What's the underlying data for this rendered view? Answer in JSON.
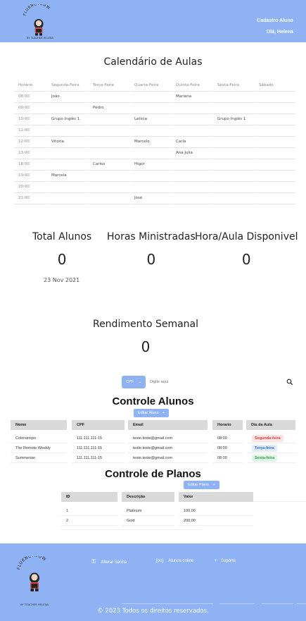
{
  "brand": {
    "name": "FLUENCYNOW",
    "tagline": "BY TEACHER HELENA"
  },
  "header": {
    "cadastro_link": "Cadastro Aluno",
    "greeting": "Olá, Helena"
  },
  "calendar": {
    "title": "Calendário de Aulas",
    "columns": [
      "Horário",
      "Segunda-Feira",
      "Terça-Feira",
      "Quarta-Feira",
      "Quinta-Feira",
      "Sexta-Feira",
      "Sábado"
    ],
    "rows": [
      [
        "08:00",
        "João",
        "",
        "",
        "Mariana",
        "",
        ""
      ],
      [
        "09:00",
        "",
        "Pedro",
        "",
        "",
        "",
        ""
      ],
      [
        "10:00",
        "Grupo Inglês 1",
        "",
        "Leticia",
        "",
        "Grupo Inglês 1",
        ""
      ],
      [
        "11:00",
        "",
        "",
        "",
        "",
        "",
        ""
      ],
      [
        "12:00",
        "Vitoria",
        "",
        "Marcelo",
        "Carla",
        "",
        ""
      ],
      [
        "13:00",
        "",
        "",
        "",
        "Ana Julia",
        "",
        ""
      ],
      [
        "18:00",
        "",
        "Carlos",
        "Higor",
        "",
        "",
        ""
      ],
      [
        "19:00",
        "Marcela",
        "",
        "",
        "",
        "",
        ""
      ],
      [
        "20:00",
        "",
        "",
        "",
        "",
        "",
        ""
      ],
      [
        "21:00",
        "",
        "",
        "José",
        "",
        "",
        ""
      ]
    ]
  },
  "stats": {
    "total_alunos": {
      "label": "Total Alunos",
      "value": "0"
    },
    "horas_ministradas": {
      "label": "Horas Ministradas",
      "value": "0"
    },
    "hora_aula": {
      "label": "Hora/Aula Disponivel",
      "value": "0"
    },
    "date": "23 Nov 2021",
    "rendimento": {
      "label": "Rendimento Semanal",
      "value": "0"
    }
  },
  "search": {
    "filter_label": "CPF",
    "placeholder": "Digite aqui"
  },
  "alunos": {
    "title": "Controle Alunos",
    "edit_label": "Editar Aluno",
    "columns": [
      "Nome",
      "CPF",
      "Email",
      "Horario",
      "Dia da Aula"
    ],
    "rows": [
      {
        "nome": "Colorsinspo",
        "cpf": "111.111.111-15",
        "email": "teste.teste@gmail.com",
        "horario": "08:00",
        "dia": "Segunda-feira",
        "dia_color": "#d63b3b",
        "dia_bg": "#fde4e4"
      },
      {
        "nome": "The Remote Weekly",
        "cpf": "111.111.111-15",
        "email": "teste.teste@gmail.com",
        "horario": "08:00",
        "dia": "Terça-feira",
        "dia_color": "#2f6fd6",
        "dia_bg": "#e1ecfd"
      },
      {
        "nome": "Summerian",
        "cpf": "111.111.111-15",
        "email": "teste.teste@gmail.com",
        "horario": "08:00",
        "dia": "Sexta-feira",
        "dia_color": "#2e9e4a",
        "dia_bg": "#e2f6e6"
      }
    ]
  },
  "planos": {
    "title": "Controle de Planos",
    "edit_label": "Editar Plano",
    "columns": [
      "ID",
      "Descrição",
      "Valor"
    ],
    "rows": [
      {
        "id": "1",
        "descricao": "Platinum",
        "valor": "100,00"
      },
      {
        "id": "2",
        "descricao": "Gold",
        "valor": "200,00"
      }
    ]
  },
  "footer": {
    "alterar_senha": "Alterar Senha",
    "alunos_online": "Alunos online",
    "suporte": "Suporte",
    "copyright": "© 2023 Todos os direitos reservados."
  },
  "colors": {
    "accent": "#8fb2f5",
    "header_cell": "#d9d9d9"
  }
}
